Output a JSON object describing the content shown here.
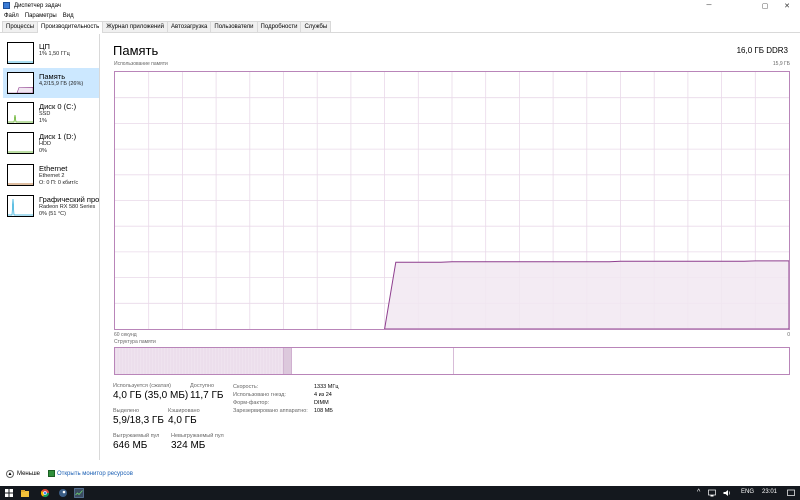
{
  "window": {
    "title": "Диспетчер задач"
  },
  "menu": [
    "Файл",
    "Параметры",
    "Вид"
  ],
  "tabs": [
    "Процессы",
    "Производительность",
    "Журнал приложений",
    "Автозагрузка",
    "Пользователи",
    "Подробности",
    "Службы"
  ],
  "active_tab_index": 1,
  "sidebar": {
    "items": [
      {
        "title": "ЦП",
        "sub1": "1% 1,50 ГГц",
        "sub2": "",
        "color": "#1ca5d7"
      },
      {
        "title": "Память",
        "sub1": "4,2/15,9 ГБ (26%)",
        "sub2": "",
        "color": "#8e3e8e"
      },
      {
        "title": "Диск 0 (C:)",
        "sub1": "SSD",
        "sub2": "1%",
        "color": "#4da60c"
      },
      {
        "title": "Диск 1 (D:)",
        "sub1": "HDD",
        "sub2": "0%",
        "color": "#4da60c"
      },
      {
        "title": "Ethernet",
        "sub1": "Ethernet 2",
        "sub2": "О: 0 П: 0 кбит/с",
        "color": "#a74f01"
      },
      {
        "title": "Графический про",
        "sub1": "Radeon RX 580 Series",
        "sub2": "0% (51 °C)",
        "color": "#1ca5d7"
      }
    ],
    "active_index": 1
  },
  "main": {
    "title": "Память",
    "type": "16,0 ГБ DDR3",
    "usage_label": "Использование памяти",
    "usage_max": "15,9 ГБ",
    "time_left": "60 секунд",
    "time_right": "0",
    "composition_label": "Структура памяти"
  },
  "usage_series": [
    0,
    0,
    0,
    0,
    0,
    0,
    0,
    0,
    0,
    0,
    0,
    0,
    0,
    0,
    0,
    0,
    0,
    0,
    0,
    0,
    0,
    0,
    0,
    0,
    0,
    0.26,
    0.26,
    0.26,
    0.26,
    0.26,
    0.262,
    0.262,
    0.262,
    0.262,
    0.262,
    0.262,
    0.262,
    0.262,
    0.262,
    0.262,
    0.262,
    0.262,
    0.262,
    0.262,
    0.262,
    0.264,
    0.264,
    0.264,
    0.264,
    0.264,
    0.264,
    0.264,
    0.264,
    0.264,
    0.264,
    0.264,
    0.264,
    0.265,
    0.265,
    0.265,
    0.265
  ],
  "composition": {
    "in_use": 0.25,
    "modified": 0.012,
    "standby": 0.24,
    "free": 0.498
  },
  "stats": {
    "in_use_label": "Используется (сжатая)",
    "in_use_value": "4,0 ГБ (35,0 МБ)",
    "available_label": "Доступно",
    "available_value": "11,7 ГБ",
    "committed_label": "Выделено",
    "committed_value": "5,9/18,3 ГБ",
    "cached_label": "Кэшировано",
    "cached_value": "4,0 ГБ",
    "paged_label": "Выгружаемый пул",
    "paged_value": "646 МБ",
    "nonpaged_label": "Невыгружаемый пул",
    "nonpaged_value": "324 МБ"
  },
  "specs": [
    {
      "k": "Скорость:",
      "v": "1333 МГц"
    },
    {
      "k": "Использовано гнезд:",
      "v": "4 из 24"
    },
    {
      "k": "Форм-фактор:",
      "v": "DIMM"
    },
    {
      "k": "Зарезервировано аппаратно:",
      "v": "108 МБ"
    }
  ],
  "footer": {
    "fewer": "Меньше",
    "resmon": "Открыть монитор ресурсов"
  },
  "taskbar": {
    "lang": "ENG",
    "time": "23:01"
  },
  "colors": {
    "accent": "#8e3e8e",
    "fill": "#f1e7f1",
    "grid": "#e9d9e9"
  }
}
